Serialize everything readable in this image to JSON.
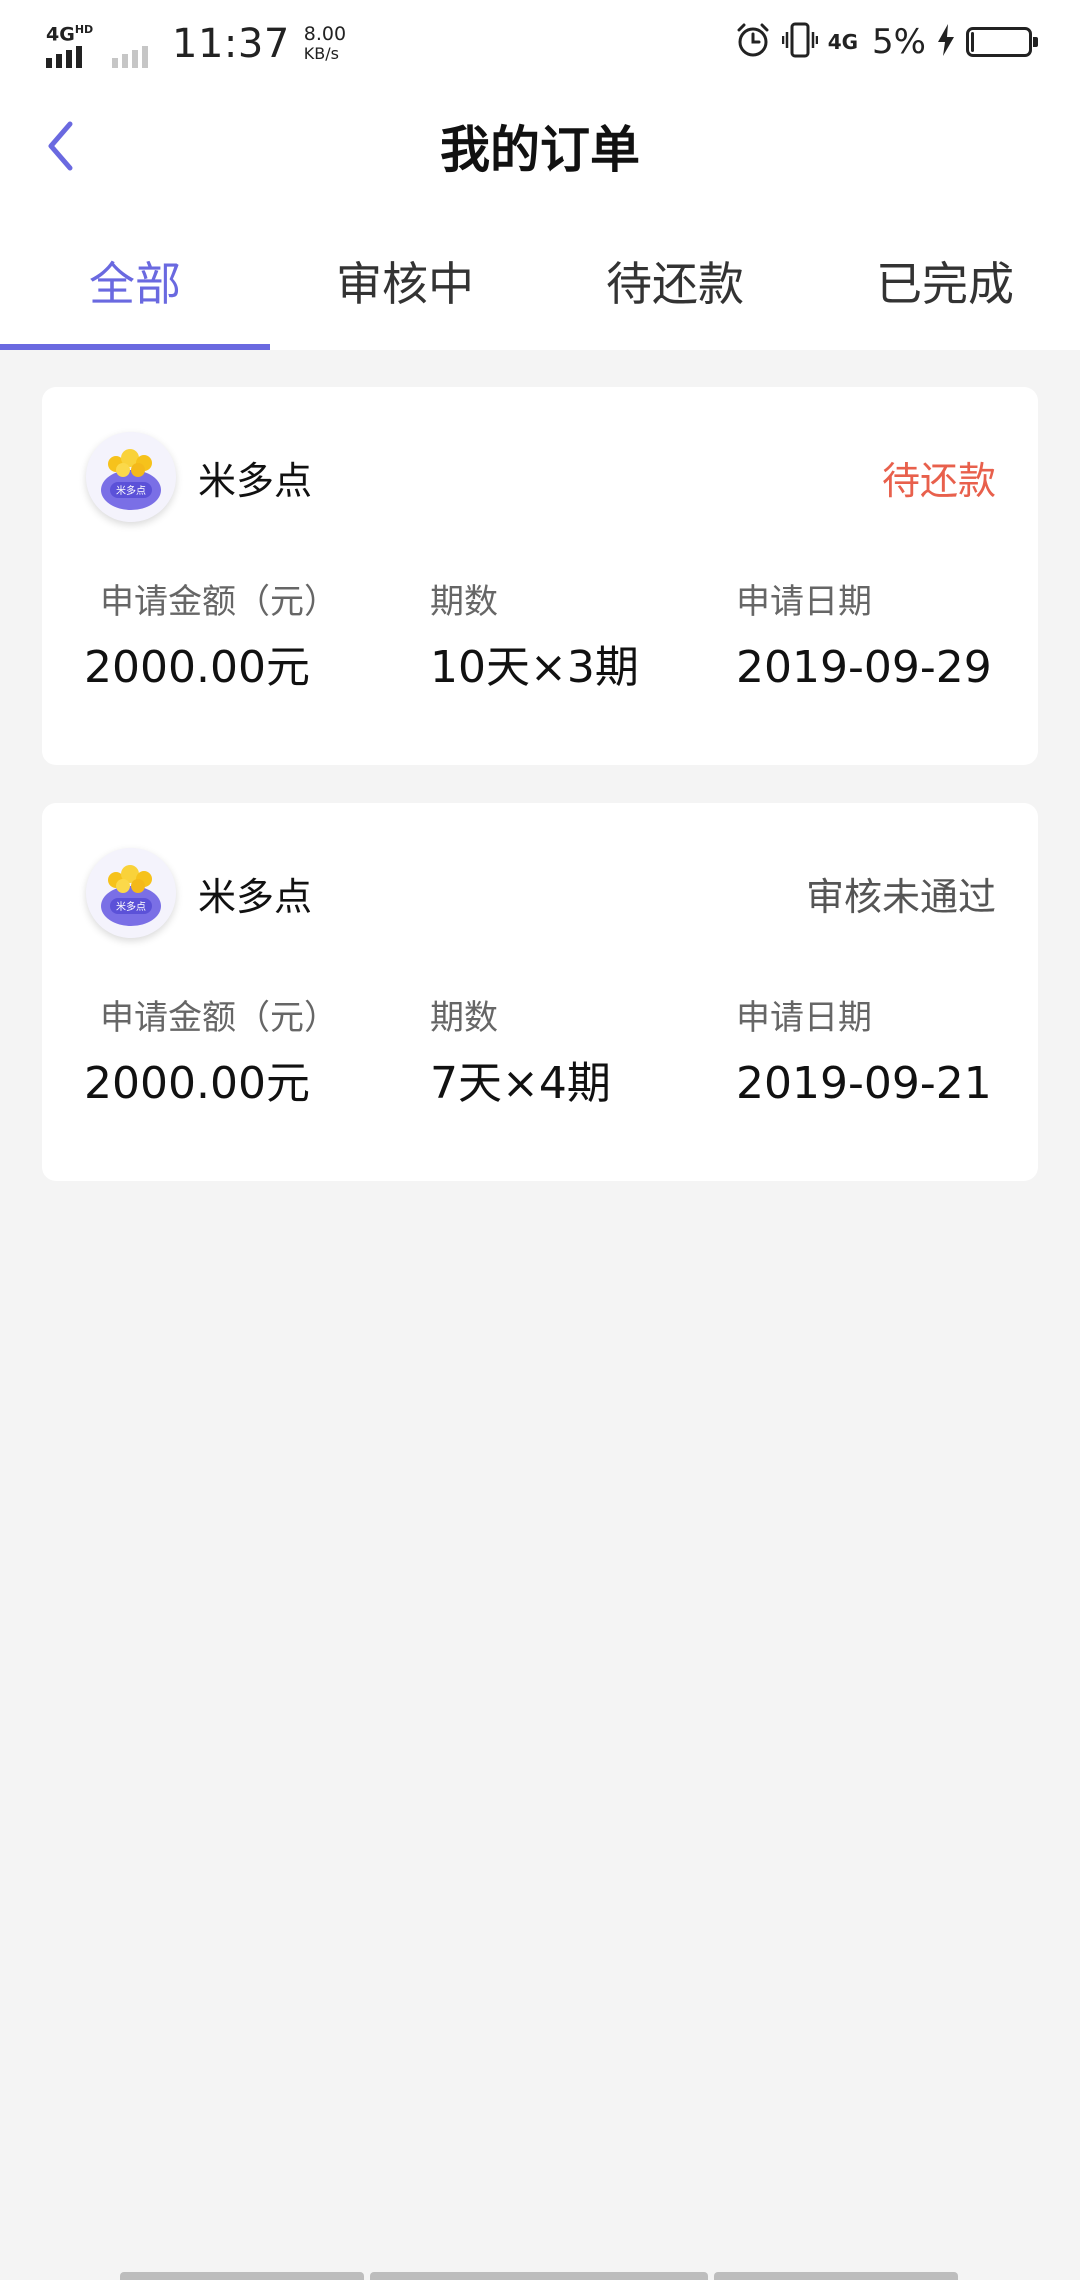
{
  "status_bar": {
    "network_type": "4G",
    "network_type_sup": "HD",
    "time": "11:37",
    "speed_value": "8.00",
    "speed_unit": "KB/s",
    "secondary_network": "4G",
    "battery_percent": "5%",
    "battery_level": 0.05,
    "icons": [
      "signal-icon",
      "alarm-icon",
      "vibrate-icon",
      "charging-icon",
      "battery-icon"
    ]
  },
  "header": {
    "title": "我的订单",
    "back_icon": "chevron-left-icon"
  },
  "tabs": [
    {
      "label": "全部",
      "active": true
    },
    {
      "label": "审核中",
      "active": false
    },
    {
      "label": "待还款",
      "active": false
    },
    {
      "label": "已完成",
      "active": false
    }
  ],
  "orders": [
    {
      "merchant": "米多点",
      "logo_text": "米多点",
      "status": "待还款",
      "status_color": "#e8604c",
      "fields": {
        "amount_label": "申请金额（元）",
        "amount_value": "2000.00元",
        "periods_label": "期数",
        "periods_value": "10天×3期",
        "date_label": "申请日期",
        "date_value": "2019-09-29"
      }
    },
    {
      "merchant": "米多点",
      "logo_text": "米多点",
      "status": "审核未通过",
      "status_color": "#555555",
      "fields": {
        "amount_label": "申请金额（元）",
        "amount_value": "2000.00元",
        "periods_label": "期数",
        "periods_value": "7天×4期",
        "date_label": "申请日期",
        "date_value": "2019-09-21"
      }
    }
  ],
  "colors": {
    "accent": "#6a69e0",
    "status_pending": "#e8604c",
    "status_rejected": "#555555",
    "background": "#f4f4f4"
  }
}
